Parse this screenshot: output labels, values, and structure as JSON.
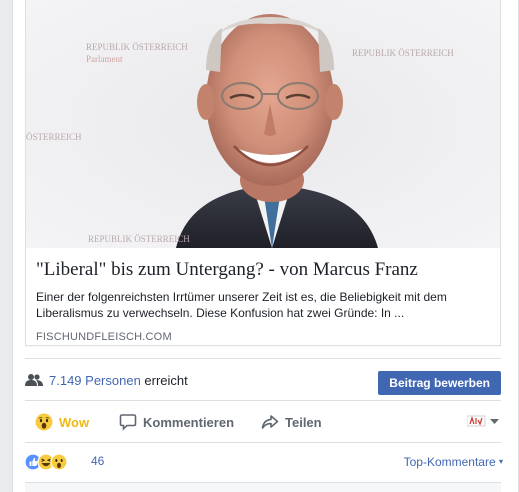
{
  "link_preview": {
    "title": "\"Liberal\" bis zum Untergang? - von Marcus Franz",
    "description": "Einer der folgenreichsten Irrtümer unserer Zeit ist es, die Beliebigkeit mit dem Liberalismus zu verwechseln. Diese Konfusion hat zwei Gründe: In ...",
    "domain": "FISCHUNDFLEISCH.COM",
    "watermarks": [
      "REPUBLIK ÖSTERREICH",
      "Parlament",
      "ÖSTERREICH",
      "REPUBLIK ÖSTERREICH",
      "REPUBLIK ÖSTERREICH"
    ]
  },
  "reach": {
    "count": "7.149 Personen",
    "suffix": "erreicht",
    "promote_label": "Beitrag bewerben"
  },
  "actions": {
    "wow_label": "Wow",
    "comment_label": "Kommentieren",
    "share_label": "Teilen"
  },
  "summary": {
    "reaction_count": "46",
    "sort_label": "Top-Kommentare"
  },
  "colors": {
    "accent": "#4267b2",
    "wow": "#f0ba15",
    "like": "#5890ff"
  }
}
